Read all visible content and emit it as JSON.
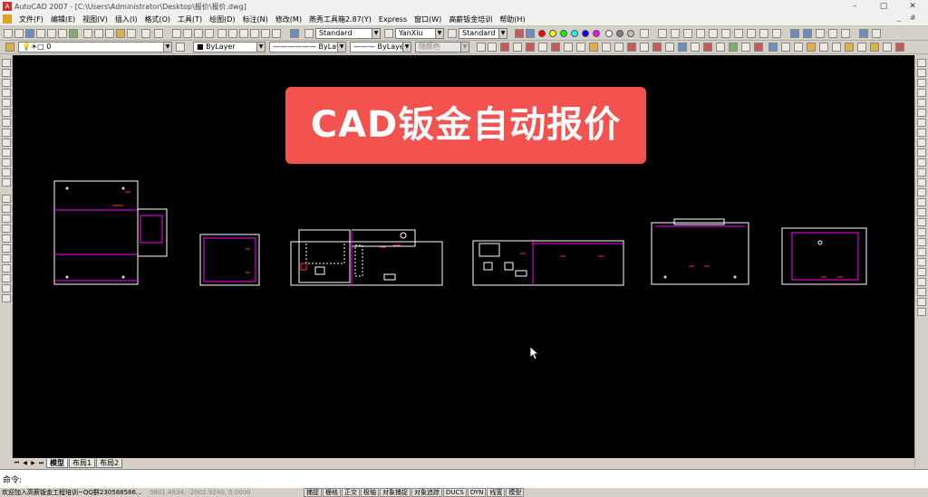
{
  "window": {
    "title": "AutoCAD 2007 - [C:\\Users\\Administrator\\Desktop\\报价\\报价.dwg]",
    "app_icon_glyph": "A",
    "controls": [
      "–",
      "▢",
      "✕"
    ]
  },
  "menubar": {
    "items": [
      "文件(F)",
      "编辑(E)",
      "视图(V)",
      "插入(I)",
      "格式(O)",
      "工具(T)",
      "绘图(D)",
      "标注(N)",
      "修改(M)",
      "燕秀工具箱2.87(Y)",
      "Express",
      "窗口(W)",
      "高薪钣金培训",
      "帮助(H)"
    ],
    "doc_controls": [
      "_",
      "#"
    ]
  },
  "toolbar": {
    "text_style": "Standard",
    "dim_style": "YanXiu",
    "table_style": "Standard",
    "layer": "0",
    "color": "ByLayer",
    "linetype": "ByLayer",
    "lineweight": "ByLayer",
    "plot_style": "随颜色",
    "palette": [
      "#ff0000",
      "#ffff00",
      "#00ff00",
      "#00ffff",
      "#0000ff",
      "#ff00ff",
      "#ffffff",
      "#808080",
      "#c0c0c0"
    ]
  },
  "banner": {
    "text": "CAD钣金自动报价",
    "color": "#f3524f"
  },
  "drawing": {
    "line_colors": [
      "#ffffff",
      "#ff00ff",
      "#ff3333"
    ]
  },
  "layout_tabs": {
    "nav": [
      "⏮",
      "◀",
      "▶",
      "⏭"
    ],
    "tabs": [
      "模型",
      "布局1",
      "布局2"
    ]
  },
  "command": {
    "prompt": "命令:"
  },
  "statusbar": {
    "message": "欢迎加入高薪钣金工程培训~QQ群230588586...",
    "coords": "9801.4834,  -2002.9240,  0.0000",
    "toggles": [
      "捕捉",
      "栅格",
      "正交",
      "极轴",
      "对象捕捉",
      "对象追踪",
      "DUCS",
      "DYN",
      "线宽",
      "模型"
    ]
  }
}
